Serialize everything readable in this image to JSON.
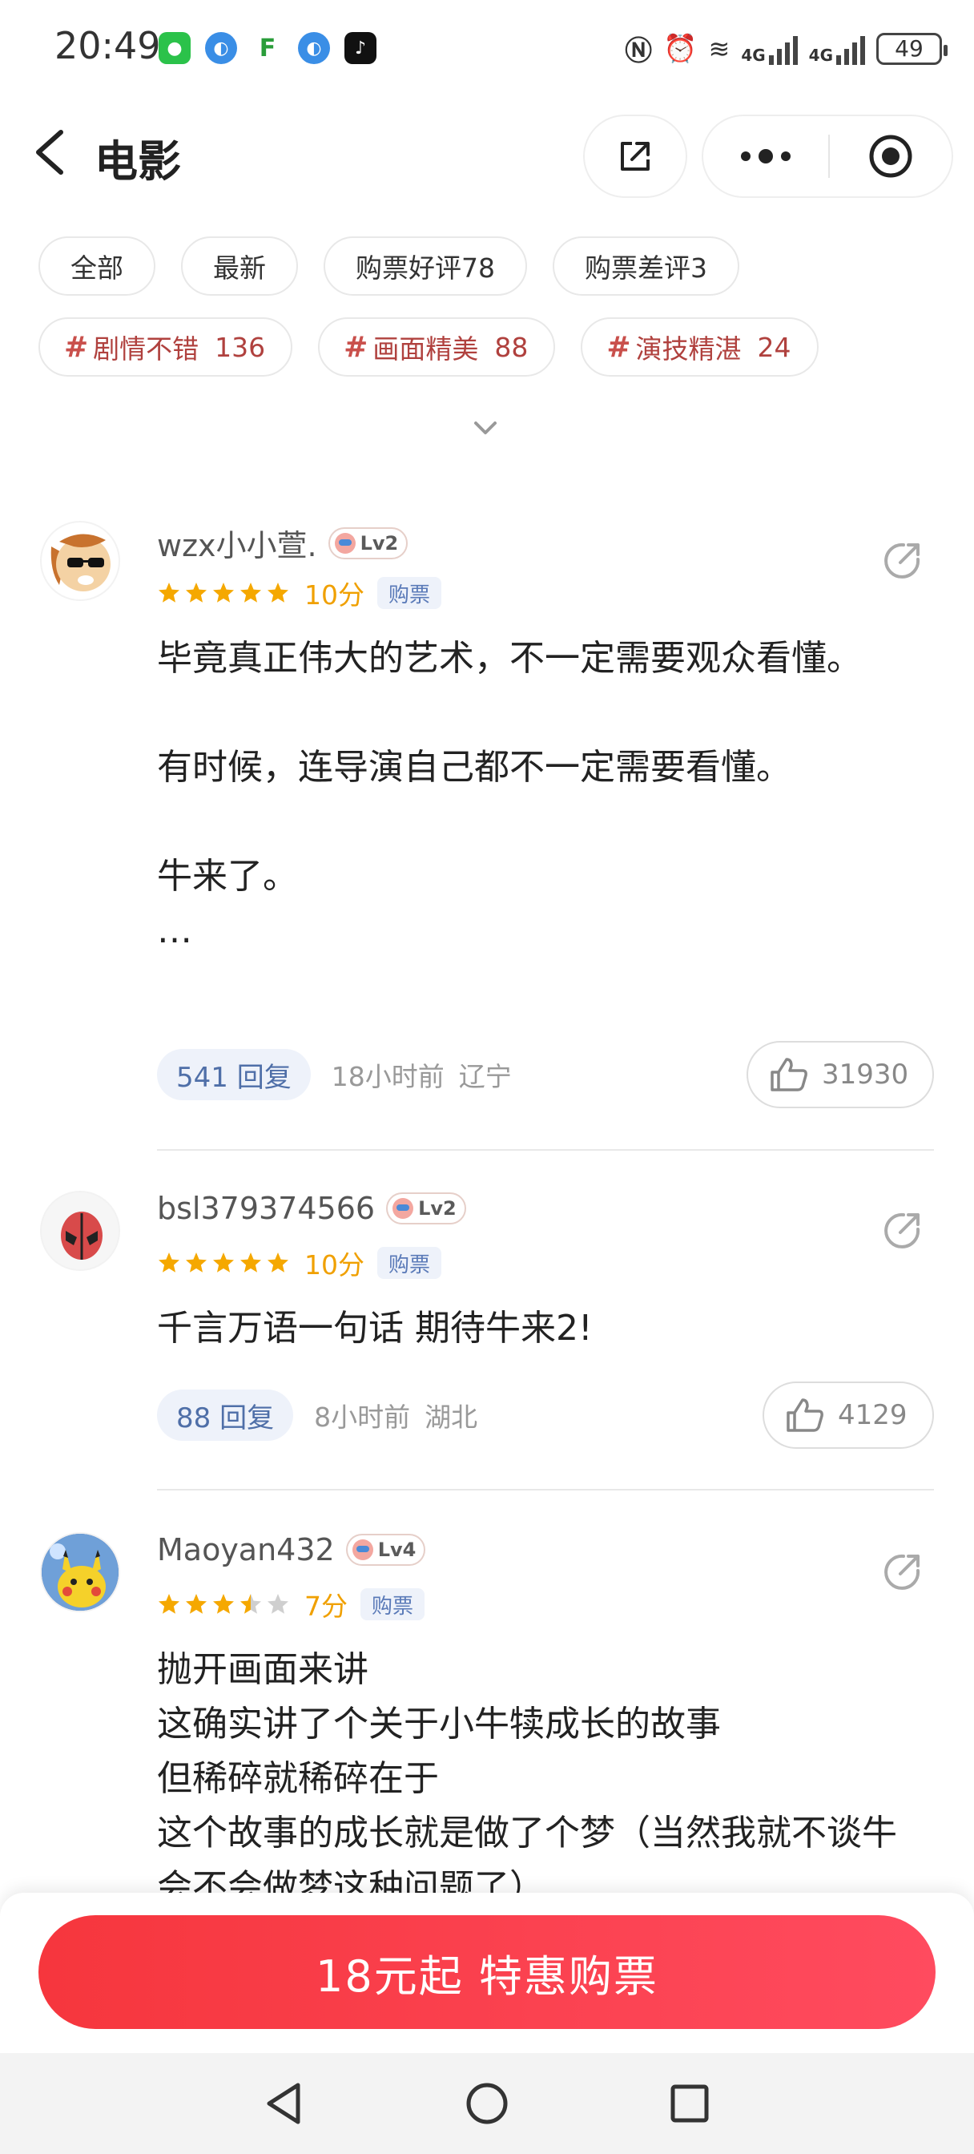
{
  "status_bar": {
    "time": "20:49",
    "network_1": "4G",
    "network_2": "4G",
    "battery": "49"
  },
  "header": {
    "title": "电影"
  },
  "filters": {
    "row1": [
      "全部",
      "最新",
      "购票好评78",
      "购票差评3"
    ],
    "tags": [
      {
        "label": "剧情不错",
        "count": "136"
      },
      {
        "label": "画面精美",
        "count": "88"
      },
      {
        "label": "演技精湛",
        "count": "24"
      }
    ]
  },
  "comments": [
    {
      "username": "wzx小小萱.",
      "level": "Lv2",
      "stars": 5,
      "score": "10分",
      "badge": "购票",
      "content": "毕竟真正伟大的艺术，不一定需要观众看懂。\n\n有时候，连导演自己都不一定需要看懂。\n\n牛来了。\n…",
      "replies": "541 回复",
      "time": "18小时前",
      "location": "辽宁",
      "likes": "31930"
    },
    {
      "username": "bsl379374566",
      "level": "Lv2",
      "stars": 5,
      "score": "10分",
      "badge": "购票",
      "content": "千言万语一句话  期待牛来2!",
      "replies": "88 回复",
      "time": "8小时前",
      "location": "湖北",
      "likes": "4129"
    },
    {
      "username": "Maoyan432",
      "level": "Lv4",
      "stars": 3.5,
      "score": "7分",
      "badge": "购票",
      "content": "抛开画面来讲\n这确实讲了个关于小牛犊成长的故事\n但稀碎就稀碎在于\n这个故事的成长就是做了个梦（当然我就不谈牛会不会做梦这种问题了）"
    }
  ],
  "buy_button": {
    "label": "18元起 特惠购票"
  },
  "colors": {
    "accent_red": "#f6363d",
    "star_gold": "#f5a800",
    "tag_red": "#b0413e"
  }
}
